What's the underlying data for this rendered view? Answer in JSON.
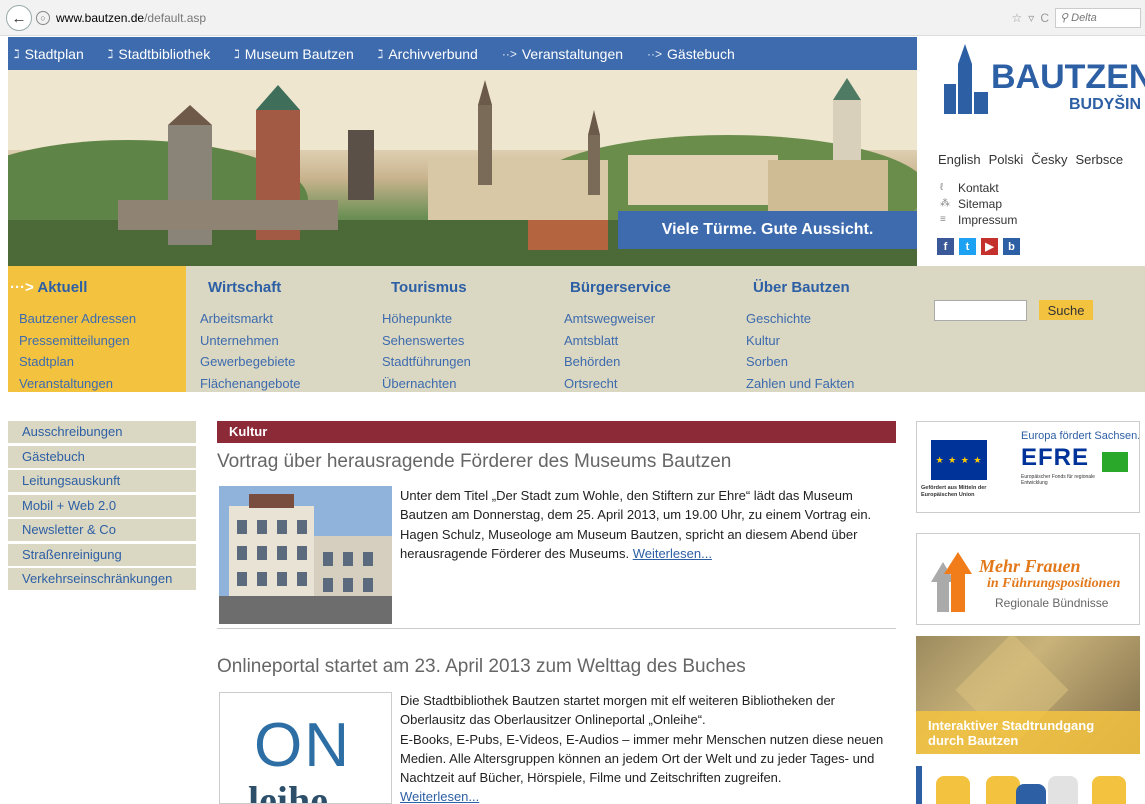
{
  "browser": {
    "url_host": "www.bautzen.de",
    "url_path": "/default.asp",
    "search_placeholder": "Delta"
  },
  "topnav": [
    {
      "label": "Stadtplan",
      "glyph": "ℷ"
    },
    {
      "label": "Stadtbibliothek",
      "glyph": "ℷ"
    },
    {
      "label": "Museum Bautzen",
      "glyph": "ℷ"
    },
    {
      "label": "Archivverbund",
      "glyph": "ℷ"
    },
    {
      "label": "Veranstaltungen",
      "glyph": "··>"
    },
    {
      "label": "Gästebuch",
      "glyph": "··>"
    }
  ],
  "banner": {
    "slogan": "Viele Türme. Gute Aussicht."
  },
  "logo": {
    "name": "BAUTZEN",
    "sub": "BUDYŠIN"
  },
  "languages": [
    "English",
    "Polski",
    "Česky",
    "Serbsce"
  ],
  "quicklinks": [
    {
      "label": "Kontakt",
      "icon": "phone-icon",
      "glyph": "ℓ"
    },
    {
      "label": "Sitemap",
      "icon": "sitemap-icon",
      "glyph": "⁂"
    },
    {
      "label": "Impressum",
      "icon": "list-icon",
      "glyph": "≡"
    }
  ],
  "social": [
    {
      "name": "facebook-icon",
      "glyph": "f",
      "color": "#3b5998"
    },
    {
      "name": "twitter-icon",
      "glyph": "t",
      "color": "#1da1f2"
    },
    {
      "name": "youtube-icon",
      "glyph": "▶",
      "color": "#c4302b"
    },
    {
      "name": "bautzen-app-icon",
      "glyph": "b",
      "color": "#2d5fa5"
    }
  ],
  "categories": [
    {
      "title": "Aktuell",
      "links": [
        "Bautzener Adressen",
        "Pressemitteilungen",
        "Stadtplan",
        "Veranstaltungen"
      ]
    },
    {
      "title": "Wirtschaft",
      "links": [
        "Arbeitsmarkt",
        "Unternehmen",
        "Gewerbegebiete",
        "Flächenangebote"
      ]
    },
    {
      "title": "Tourismus",
      "links": [
        "Höhepunkte",
        "Sehenswertes",
        "Stadtführungen",
        "Übernachten"
      ]
    },
    {
      "title": "Bürgerservice",
      "links": [
        "Amtswegweiser",
        "Amtsblatt",
        "Behörden",
        "Ortsrecht"
      ]
    },
    {
      "title": "Über Bautzen",
      "links": [
        "Geschichte",
        "Kultur",
        "Sorben",
        "Zahlen und Fakten"
      ]
    }
  ],
  "search": {
    "button": "Suche",
    "value": ""
  },
  "leftnav": [
    "Ausschreibungen",
    "Gästebuch",
    "Leitungsauskunft",
    "Mobil + Web 2.0",
    "Newsletter & Co",
    "Straßenreinigung",
    "Verkehrseinschränkungen"
  ],
  "section": {
    "label": "Kultur"
  },
  "articles": [
    {
      "title": "Vortrag über herausragende Förderer des Museums Bautzen",
      "text": "Unter dem Titel „Der Stadt zum Wohle, den Stiftern zur Ehre“ lädt das Museum Bautzen am Donnerstag, dem 25. April 2013, um 19.00 Uhr, zu einem Vortrag ein. Hagen Schulz, Museologe am Museum Bautzen, spricht an diesem Abend über herausragende Förderer des Museums.",
      "more": "Weiterlesen..."
    },
    {
      "title": "Onlineportal startet am 23. April 2013 zum Welttag des Buches",
      "text1": "Die Stadtbibliothek Bautzen startet morgen mit elf weiteren Bibliotheken der Oberlausitz das Oberlausitzer Onlineportal „Onleihe“.",
      "text2": "E-Books, E-Pubs, E-Videos, E-Audios – immer mehr Menschen nutzen diese neuen Medien. Alle Altersgruppen können an jedem Ort der Welt und zu jeder Tages- und Nachtzeit auf Bücher, Hörspiele, Filme und Zeitschriften zugreifen.",
      "more": "Weiterlesen...",
      "logo_top": "ON",
      "logo_bottom": "leihe"
    }
  ],
  "ads": {
    "efre": {
      "headline": "Europa fördert Sachsen.",
      "logo": "EFRE",
      "sub": "Europäischer Fonds für regionale Entwicklung",
      "caption": "Gefördert aus Mitteln der Europäischen Union"
    },
    "frauen": {
      "line1": "Mehr Frauen",
      "line2": "in Führungspositionen",
      "line3": "Regionale Bündnisse"
    },
    "rundgang": {
      "text": "Interaktiver Stadtrundgang durch Bautzen"
    }
  },
  "colors": {
    "nav_blue": "#3d6bae",
    "yellow": "#f3c340",
    "band": "#dad7c2",
    "section": "#8c2a38"
  }
}
